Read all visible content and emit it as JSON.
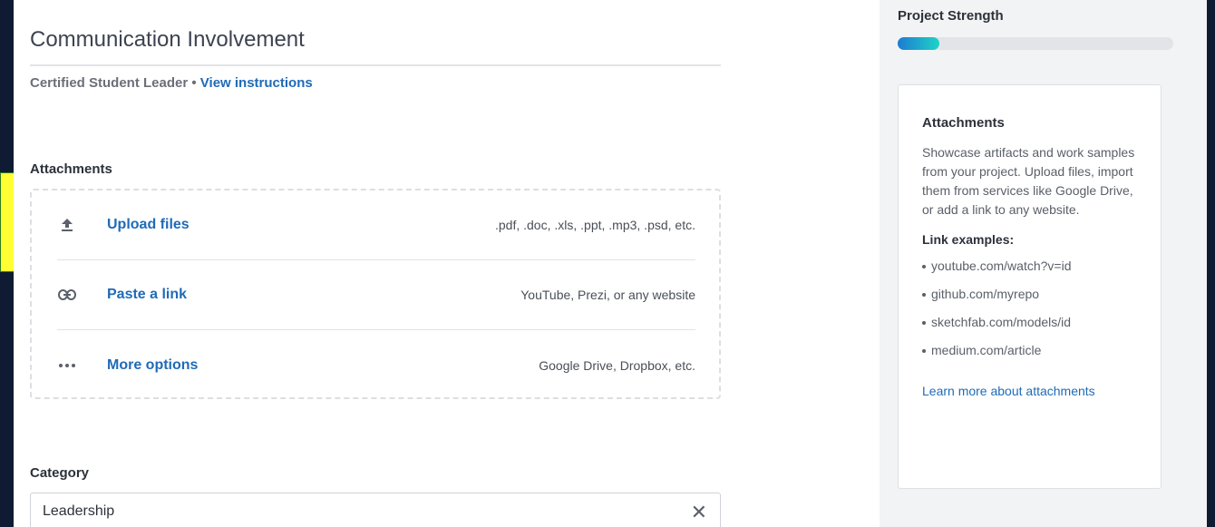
{
  "main": {
    "title": "Communication Involvement",
    "subline": {
      "role": "Certified Student Leader",
      "separator": " • ",
      "instructions_link": "View instructions"
    },
    "attachments": {
      "heading": "Attachments",
      "rows": [
        {
          "icon": "upload-icon",
          "label": "Upload files",
          "hint": ".pdf, .doc, .xls, .ppt, .mp3, .psd, etc."
        },
        {
          "icon": "link-icon",
          "label": "Paste a link",
          "hint": "YouTube, Prezi, or any website"
        },
        {
          "icon": "more-icon",
          "label": "More options",
          "hint": "Google Drive, Dropbox, etc."
        }
      ]
    },
    "category": {
      "heading": "Category",
      "value": "Leadership",
      "clear_icon": "close-icon"
    }
  },
  "sidebar": {
    "strength": {
      "label": "Project Strength",
      "progress": 0.15,
      "colors": [
        "#1c7bd1",
        "#1fd3c7"
      ]
    },
    "info": {
      "title": "Attachments",
      "description": "Showcase artifacts and work samples from your project. Upload files, import them from services like Google Drive, or add a link to any website.",
      "examples_heading": "Link examples:",
      "examples": [
        "youtube.com/watch?v=id",
        "github.com/myrepo",
        "sketchfab.com/models/id",
        "medium.com/article"
      ],
      "learn_more": "Learn more about attachments"
    }
  },
  "colors": {
    "background": "#0f1a33",
    "link": "#1f6bb8",
    "pointer": "#ffff33"
  }
}
